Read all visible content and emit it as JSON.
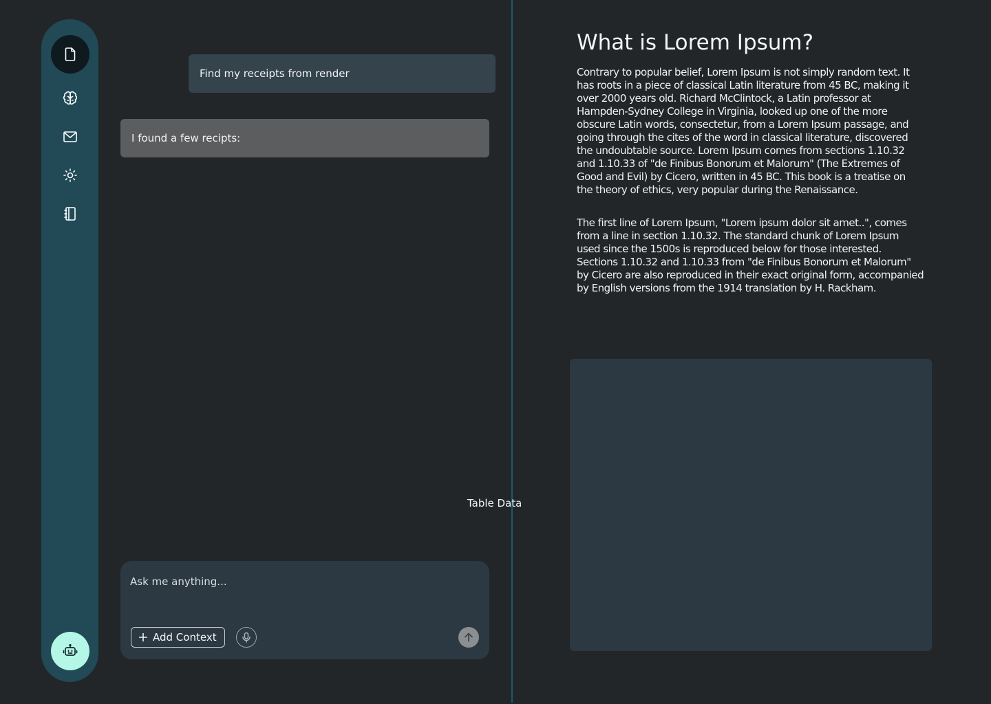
{
  "sidebar": {
    "items": [
      {
        "icon": "document-icon",
        "active": true
      },
      {
        "icon": "brain-icon",
        "active": false
      },
      {
        "icon": "mail-icon",
        "active": false
      },
      {
        "icon": "sun-icon",
        "active": false
      },
      {
        "icon": "notebook-icon",
        "active": false
      }
    ],
    "assistant_icon": "robot-icon",
    "colors": {
      "background": "#214a56",
      "active": "#0f1a1e",
      "assistant": "#b4f7e6"
    }
  },
  "chat": {
    "user_message": "Find my receipts from render",
    "bot_message": "I found a few recipts:",
    "table_label": "Table Data"
  },
  "composer": {
    "placeholder": "Ask me anything...",
    "add_context_label": "Add Context",
    "mic_icon": "microphone-icon",
    "send_icon": "arrow-up-icon"
  },
  "article": {
    "title": "What is Lorem Ipsum?",
    "paragraphs": [
      "Contrary to popular belief, Lorem Ipsum is not simply random text. It has roots in a piece of classical Latin literature from 45 BC, making  it over 2000 years old. Richard McClintock, a Latin professor at  Hampden-Sydney College in Virginia, looked up one of the more obscure  Latin words, consectetur, from a Lorem Ipsum passage, and going through  the cites of the word in classical literature, discovered the  undoubtable source. Lorem Ipsum comes from sections 1.10.32 and 1.10.33  of \"de Finibus Bonorum et Malorum\" (The Extremes of Good and Evil) by  Cicero, written in 45 BC. This book is a treatise on the theory of  ethics, very popular during the Renaissance.",
      "The first line of Lorem  Ipsum, \"Lorem ipsum dolor sit amet..\", comes from a line in section  1.10.32. The standard chunk of Lorem Ipsum used since the 1500s is reproduced below for those interested. Sections 1.10.32 and 1.10.33  from \"de Finibus Bonorum et Malorum\" by Cicero are also reproduced in  their exact original form, accompanied by English versions from the 1914 translation by H. Rackham."
    ]
  }
}
